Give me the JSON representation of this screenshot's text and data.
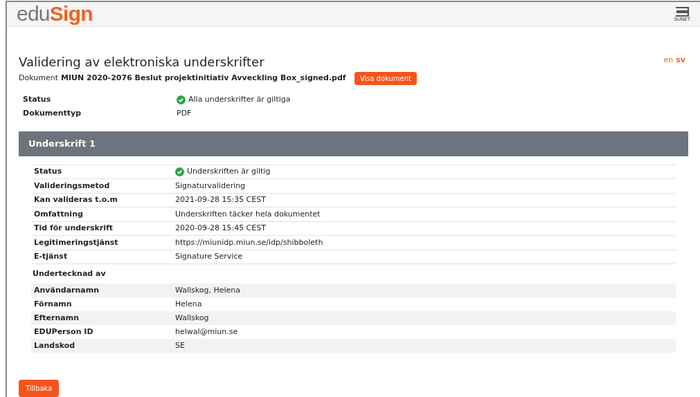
{
  "header": {
    "logo_prefix": "edu",
    "logo_suffix": "Sign",
    "partner_logo": "SUNET"
  },
  "languages": [
    {
      "label": "en",
      "selected": false
    },
    {
      "label": "sv",
      "selected": true
    }
  ],
  "title": "Validering av elektroniska underskrifter",
  "document": {
    "label": "Dokument",
    "name": "MIUN 2020-2076 Beslut projektinitiativ Avveckling Box_signed.pdf",
    "button": "Visa dokument"
  },
  "summary": [
    {
      "label": "Status",
      "value": "Alla underskrifter är giltiga",
      "kind": "status"
    },
    {
      "label": "Dokumenttyp",
      "value": "PDF",
      "kind": "text"
    }
  ],
  "signature": {
    "title": "Underskrift 1",
    "rows": [
      {
        "label": "Status",
        "value": "Underskriften är giltig",
        "kind": "status"
      },
      {
        "label": "Valideringsmetod",
        "value": "Signaturvalidering",
        "kind": "text"
      },
      {
        "label": "Kan valideras t.o.m",
        "value": "2021-09-28 15:35 CEST",
        "kind": "text"
      },
      {
        "label": "Omfattning",
        "value": "Underskriften täcker hela dokumentet",
        "kind": "text"
      },
      {
        "label": "Tid för underskrift",
        "value": "2020-09-28 15:45 CEST",
        "kind": "text"
      },
      {
        "label": "Legitimeringstjänst",
        "value": "https://miunidp.miun.se/idp/shibboleth",
        "kind": "text"
      },
      {
        "label": "E-tjänst",
        "value": "Signature Service",
        "kind": "text"
      }
    ],
    "signer_heading": "Undertecknad av",
    "signer_rows": [
      {
        "label": "Användarnamn",
        "value": "Wallskog, Helena"
      },
      {
        "label": "Förnamn",
        "value": "Helena"
      },
      {
        "label": "Efternamn",
        "value": "Wallskog"
      },
      {
        "label": "EDUPerson ID",
        "value": "helwal@miun.se"
      },
      {
        "label": "Landskod",
        "value": "SE"
      }
    ]
  },
  "back_button": "Tillbaka"
}
